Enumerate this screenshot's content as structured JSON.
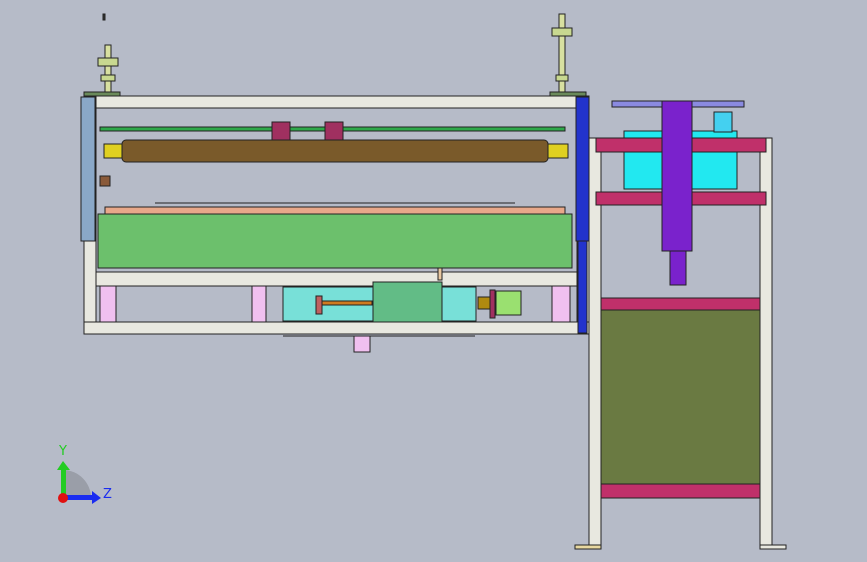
{
  "viewport": {
    "background": "#b6bbc8",
    "triad": {
      "y_label": "Y",
      "z_label": "Z",
      "y_color": "#22cc22",
      "z_color": "#1a2cf0",
      "x_color": "#e01010"
    }
  },
  "colors": {
    "frame": "#e8e8e0",
    "frame_line": "#222222",
    "green_panel": "#6cc06c",
    "roller": "#7a5a2a",
    "blue_side": "#2233cc",
    "magenta_beam": "#c0306a",
    "purple_column": "#7a22cc",
    "cyan_box": "#22e8f0",
    "olive_panel": "#6a7a42",
    "cylinder_cyan": "#78e0d8"
  }
}
